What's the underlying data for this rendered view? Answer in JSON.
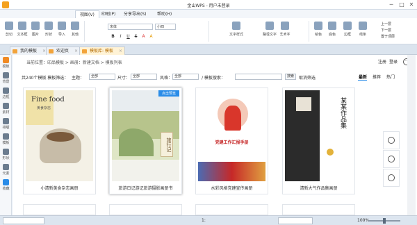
{
  "window": {
    "title": "金山WPS - 用户未登录",
    "minimize": "─",
    "maximize": "□",
    "close": "✕"
  },
  "menu_tabs": [
    "视图(V)",
    "印刷(P)",
    "分享导出(S)",
    "帮助(H)"
  ],
  "ribbon": {
    "left_buttons": [
      "剪切",
      "文本框",
      "图片",
      "形状",
      "导入",
      "其他"
    ],
    "font_name": "宋体",
    "font_size": "小四",
    "text_styles": [
      "B",
      "I",
      "U",
      "S",
      "A",
      "A"
    ],
    "right_buttons": [
      "文字样式",
      "路径文字",
      "艺术字",
      "绘色",
      "底色",
      "边框",
      "线条",
      "文字",
      "图框",
      "其他"
    ],
    "layer_buttons": [
      "上一层",
      "下一层",
      "置于顶层",
      "置于底层"
    ]
  },
  "doc_tabs": [
    {
      "label": "我的模板"
    },
    {
      "label": "欢迎页"
    },
    {
      "label": "模板库: 模板"
    }
  ],
  "top_right": {
    "register": "注册",
    "login": "登录",
    "more_icon": "more-icon"
  },
  "left_sidebar": [
    "模板",
    "背景",
    "边框",
    "素材",
    "排版",
    "模板",
    "形状",
    "元素",
    "收藏"
  ],
  "breadcrumb": "当前位置：印品模板 > 画册：新建文档 > 模板列表",
  "crumb_right": "返回",
  "filter": {
    "count": "共240个模板  模板筛选：",
    "topic_label": "主题：",
    "topic_value": "全部",
    "size_label": "尺寸：",
    "size_value": "全部",
    "style_label": "风格：",
    "style_value": "全部",
    "search_label": "/ 模板搜索：",
    "search_button": "搜索",
    "cancel": "取消筛选"
  },
  "sort": [
    "最新",
    "推荐",
    "热门"
  ],
  "cards": [
    {
      "name": "小清新美食杂志画册",
      "cover_title": "Fine food",
      "cover_sub": "美食杂志"
    },
    {
      "name": "旅游日记游记旅游摄影画册书",
      "badge": "点击预览",
      "cover_text": "旅行记"
    },
    {
      "name": "水彩风格党建宣传画册",
      "cover_text": "党建工作汇报手册"
    },
    {
      "name": "清新大气作品集画册",
      "cover_text": "某某作品集"
    }
  ],
  "status": {
    "page_label": "1:",
    "zoom": "100%"
  }
}
